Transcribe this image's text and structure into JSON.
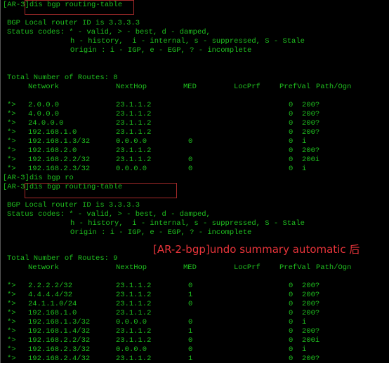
{
  "terminal": {
    "text_color": "#1fbf1f",
    "highlight_box_color": "#a52a2a",
    "annotation_color": "#e8343a",
    "prompt": "[AR-3]",
    "block1": {
      "command": "dis bgp routing-table",
      "router_id_line": "BGP Local router ID is 3.3.3.3",
      "status_line1": "Status codes: * - valid, > - best, d - damped,",
      "status_line2": "h - history,  i - internal, s - suppressed, S - Stale",
      "origin_line": "Origin : i - IGP, e - EGP, ? - incomplete",
      "total_line": "Total Number of Routes: 8",
      "headers": [
        "Network",
        "NextHop",
        "MED",
        "LocPrf",
        "PrefVal",
        "Path/Ogn"
      ],
      "rows": [
        {
          "status": "*>",
          "network": "2.0.0.0",
          "nexthop": "23.1.1.2",
          "med": "",
          "locprf": "",
          "prefval": "0",
          "path": "200?"
        },
        {
          "status": "*>",
          "network": "4.0.0.0",
          "nexthop": "23.1.1.2",
          "med": "",
          "locprf": "",
          "prefval": "0",
          "path": "200?"
        },
        {
          "status": "*>",
          "network": "24.0.0.0",
          "nexthop": "23.1.1.2",
          "med": "",
          "locprf": "",
          "prefval": "0",
          "path": "200?"
        },
        {
          "status": "*>",
          "network": "192.168.1.0",
          "nexthop": "23.1.1.2",
          "med": "",
          "locprf": "",
          "prefval": "0",
          "path": "200?"
        },
        {
          "status": "*>",
          "network": "192.168.1.3/32",
          "nexthop": "0.0.0.0",
          "med": "0",
          "locprf": "",
          "prefval": "0",
          "path": "i"
        },
        {
          "status": "*>",
          "network": "192.168.2.0",
          "nexthop": "23.1.1.2",
          "med": "",
          "locprf": "",
          "prefval": "0",
          "path": "200?"
        },
        {
          "status": "*>",
          "network": "192.168.2.2/32",
          "nexthop": "23.1.1.2",
          "med": "0",
          "locprf": "",
          "prefval": "0",
          "path": "200i"
        },
        {
          "status": "*>",
          "network": "192.168.2.3/32",
          "nexthop": "0.0.0.0",
          "med": "0",
          "locprf": "",
          "prefval": "0",
          "path": "i"
        }
      ]
    },
    "partial_command": "dis bgp ro",
    "block2": {
      "command": "dis bgp routing-table",
      "router_id_line": "BGP Local router ID is 3.3.3.3",
      "status_line1": "Status codes: * - valid, > - best, d - damped,",
      "status_line2": "h - history,  i - internal, s - suppressed, S - Stale",
      "origin_line": "Origin : i - IGP, e - EGP, ? - incomplete",
      "total_line": "Total Number of Routes: 9",
      "headers": [
        "Network",
        "NextHop",
        "MED",
        "LocPrf",
        "PrefVal",
        "Path/Ogn"
      ],
      "rows": [
        {
          "status": "*>",
          "network": "2.2.2.2/32",
          "nexthop": "23.1.1.2",
          "med": "0",
          "locprf": "",
          "prefval": "0",
          "path": "200?"
        },
        {
          "status": "*>",
          "network": "4.4.4.4/32",
          "nexthop": "23.1.1.2",
          "med": "1",
          "locprf": "",
          "prefval": "0",
          "path": "200?"
        },
        {
          "status": "*>",
          "network": "24.1.1.0/24",
          "nexthop": "23.1.1.2",
          "med": "0",
          "locprf": "",
          "prefval": "0",
          "path": "200?"
        },
        {
          "status": "*>",
          "network": "192.168.1.0",
          "nexthop": "23.1.1.2",
          "med": "",
          "locprf": "",
          "prefval": "0",
          "path": "200?"
        },
        {
          "status": "*>",
          "network": "192.168.1.3/32",
          "nexthop": "0.0.0.0",
          "med": "0",
          "locprf": "",
          "prefval": "0",
          "path": "i"
        },
        {
          "status": "*>",
          "network": "192.168.1.4/32",
          "nexthop": "23.1.1.2",
          "med": "1",
          "locprf": "",
          "prefval": "0",
          "path": "200?"
        },
        {
          "status": "*>",
          "network": "192.168.2.2/32",
          "nexthop": "23.1.1.2",
          "med": "0",
          "locprf": "",
          "prefval": "0",
          "path": "200i"
        },
        {
          "status": "*>",
          "network": "192.168.2.3/32",
          "nexthop": "0.0.0.0",
          "med": "0",
          "locprf": "",
          "prefval": "0",
          "path": "i"
        },
        {
          "status": "*>",
          "network": "192.168.2.4/32",
          "nexthop": "23.1.1.2",
          "med": "1",
          "locprf": "",
          "prefval": "0",
          "path": "200?"
        }
      ]
    },
    "annotation": "[AR-2-bgp]undo summary automatic 后"
  }
}
